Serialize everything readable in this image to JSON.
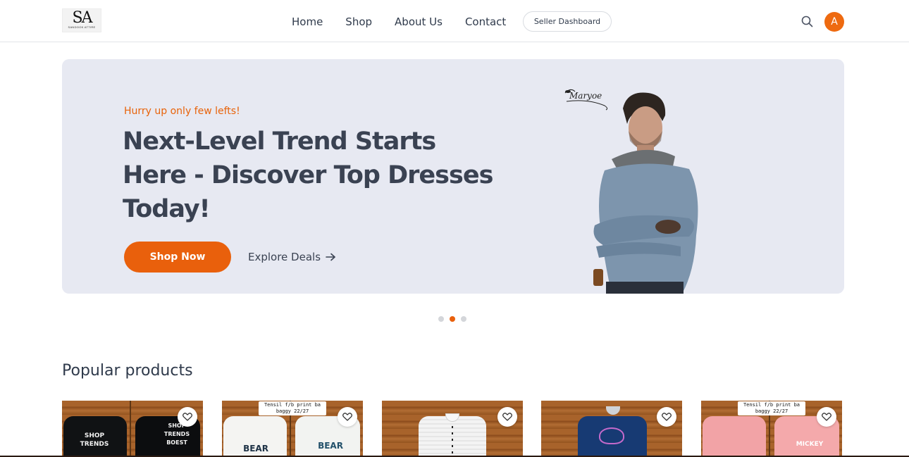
{
  "brand": {
    "logo_mark": "SA",
    "logo_subtext": "SANDOOK ATTIRE"
  },
  "nav": {
    "items": [
      {
        "label": "Home"
      },
      {
        "label": "Shop"
      },
      {
        "label": "About Us"
      },
      {
        "label": "Contact"
      }
    ],
    "seller_dashboard_label": "Seller Dashboard",
    "avatar_initial": "A"
  },
  "hero": {
    "tagline": "Hurry up only few lefts!",
    "title": "Next-Level Trend Starts Here - Discover Top Dresses Today!",
    "primary_cta": "Shop Now",
    "secondary_cta": "Explore Deals",
    "signature_label": "Maryoe"
  },
  "carousel": {
    "slides": 3,
    "active_slide": 2
  },
  "popular": {
    "title": "Popular products",
    "products": [
      {
        "image_text": "",
        "print_left": "SHOP TRENDS",
        "print_right": "SHOP TRENDS BOEST"
      },
      {
        "image_text": "Tensil f/b print ba baggy 22/27",
        "print_left": "BEAR",
        "print_right": "BEAR"
      },
      {
        "image_text": "",
        "print_left": "",
        "print_right": ""
      },
      {
        "image_text": "",
        "print_left": "",
        "print_right": ""
      },
      {
        "image_text": "Tensil f/b print ba baggy 22/27",
        "print_left": "",
        "print_right": "MICKEY"
      }
    ]
  },
  "colors": {
    "accent": "#e9600c",
    "text": "#2f3a4b",
    "hero_bg": "#e7e9f2"
  },
  "icons": [
    "search-icon",
    "heart-icon",
    "arrow-right-icon"
  ]
}
